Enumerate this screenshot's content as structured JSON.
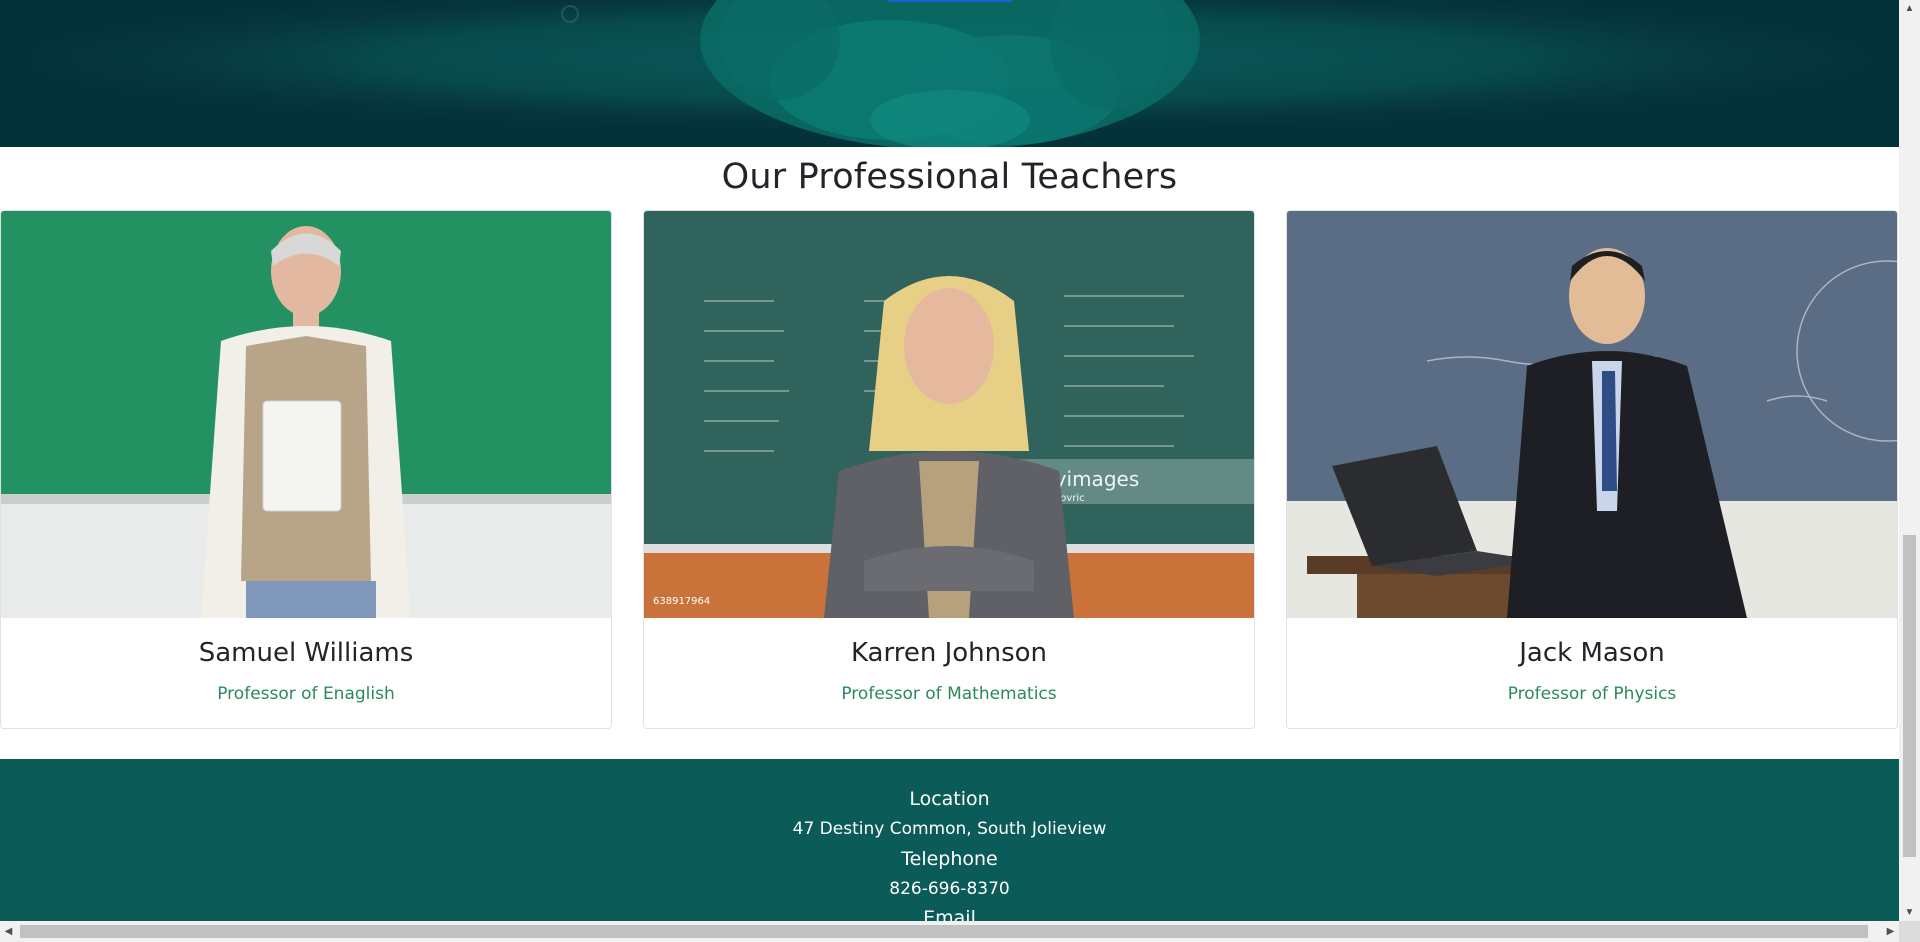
{
  "section": {
    "title": "Our Professional Teachers"
  },
  "teachers": [
    {
      "name": "Samuel Williams",
      "role": "Professor of Enaglish",
      "photo": "teacher-photo-chalkboard-green"
    },
    {
      "name": "Karren Johnson",
      "role": "Professor of Mathematics",
      "photo": "teacher-photo-chalkboard-formulas",
      "watermark": "gettyimages",
      "watermark_credit": "Drazen Lovric",
      "image_id": "638917964"
    },
    {
      "name": "Jack Mason",
      "role": "Professor of Physics",
      "photo": "teacher-photo-lecture-laptop"
    }
  ],
  "footer": {
    "location_label": "Location",
    "location_value": "47 Destiny Common, South Jolieview",
    "telephone_label": "Telephone",
    "telephone_value": "826-696-8370",
    "email_label": "Email"
  },
  "scrollbars": {
    "up": "▲",
    "down": "▼",
    "left": "◀",
    "right": "▶"
  },
  "colors": {
    "hero_dark": "#052a33",
    "hero_teal": "#0f7a72",
    "footer_bg": "#0b5c58",
    "role_text": "#2a8a5a"
  }
}
